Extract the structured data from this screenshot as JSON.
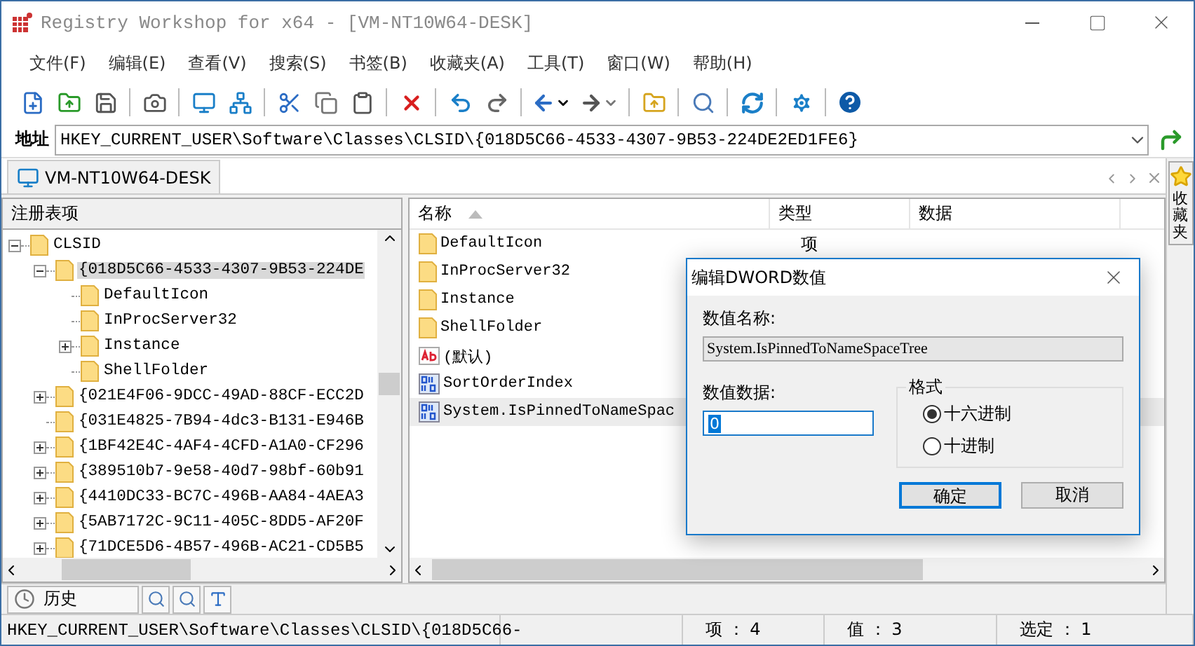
{
  "window": {
    "title": "Registry Workshop for x64 - [VM-NT10W64-DESK]"
  },
  "menu": [
    "文件(F)",
    "编辑(E)",
    "查看(V)",
    "搜索(S)",
    "书签(B)",
    "收藏夹(A)",
    "工具(T)",
    "窗口(W)",
    "帮助(H)"
  ],
  "address": {
    "label": "地址",
    "value": "HKEY_CURRENT_USER\\Software\\Classes\\CLSID\\{018D5C66-4533-4307-9B53-224DE2ED1FE6}"
  },
  "document_tab": {
    "label": "VM-NT10W64-DESK",
    "selected": true
  },
  "side_tab": {
    "label": "收藏夹"
  },
  "tree": {
    "title": "注册表项",
    "items": [
      {
        "label": "CLSID",
        "kind": "expanded",
        "selected": false,
        "children": [
          {
            "label": "{018D5C66-4533-4307-9B53-224DE",
            "kind": "expanded",
            "selected": true,
            "children": [
              {
                "label": "DefaultIcon",
                "kind": "leaf",
                "selected": false
              },
              {
                "label": "InProcServer32",
                "kind": "leaf",
                "selected": false
              },
              {
                "label": "Instance",
                "kind": "collapsed",
                "selected": false
              },
              {
                "label": "ShellFolder",
                "kind": "leaf",
                "selected": false
              }
            ]
          },
          {
            "label": "{021E4F06-9DCC-49AD-88CF-ECC2D",
            "kind": "collapsed",
            "selected": false
          },
          {
            "label": "{031E4825-7B94-4dc3-B131-E946B",
            "kind": "leaf",
            "selected": false
          },
          {
            "label": "{1BF42E4C-4AF4-4CFD-A1A0-CF296",
            "kind": "collapsed",
            "selected": false
          },
          {
            "label": "{389510b7-9e58-40d7-98bf-60b91",
            "kind": "collapsed",
            "selected": false
          },
          {
            "label": "{4410DC33-BC7C-496B-AA84-4AEA3",
            "kind": "collapsed",
            "selected": false
          },
          {
            "label": "{5AB7172C-9C11-405C-8DD5-AF20F",
            "kind": "collapsed",
            "selected": false
          },
          {
            "label": "{71DCE5D6-4B57-496B-AC21-CD5B5",
            "kind": "collapsed",
            "selected": false
          }
        ]
      }
    ]
  },
  "values": {
    "columns": [
      "名称",
      "类型",
      "数据"
    ],
    "rows": [
      {
        "name": "DefaultIcon",
        "kind": "folder",
        "type": "项",
        "selected": false
      },
      {
        "name": "InProcServer32",
        "kind": "folder",
        "selected": false
      },
      {
        "name": "Instance",
        "kind": "folder",
        "selected": false
      },
      {
        "name": "ShellFolder",
        "kind": "folder",
        "selected": false
      },
      {
        "name": "(默认)",
        "kind": "string",
        "selected": false
      },
      {
        "name": "SortOrderIndex",
        "kind": "dword",
        "selected": false
      },
      {
        "name": "System.IsPinnedToNameSpac",
        "kind": "dword",
        "selected": true
      }
    ]
  },
  "bottom_tab": {
    "label": "历史",
    "selected": true
  },
  "status_bar": {
    "path": "HKEY_CURRENT_USER\\Software\\Classes\\CLSID\\{018D5C66-",
    "keys": "项 ： 4",
    "values": "值 ： 3",
    "selected": "选定 ： 1"
  },
  "dialog": {
    "title": "编辑DWORD数值",
    "name_label": "数值名称:",
    "name_value": "System.IsPinnedToNameSpaceTree",
    "data_label": "数值数据:",
    "data_value": "0",
    "format_label": "格式",
    "formats": [
      {
        "label": "十六进制",
        "selected": true
      },
      {
        "label": "十进制",
        "selected": false
      }
    ],
    "buttons": [
      {
        "label": "确定",
        "kind": "default"
      },
      {
        "label": "取消",
        "kind": "normal"
      }
    ]
  }
}
